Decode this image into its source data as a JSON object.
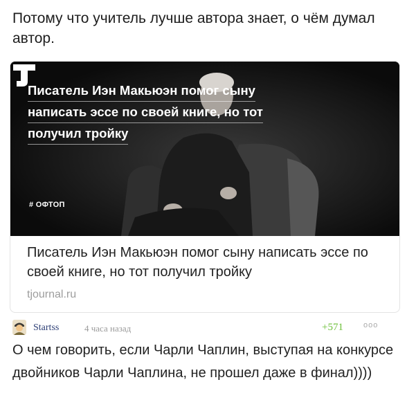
{
  "post": {
    "text": "Потому что учитель лучше автора знает, о чём думал автор."
  },
  "link_card": {
    "image": {
      "overlay_title_lines": [
        "Писатель Иэн Макьюэн помог сыну",
        "написать эссе по своей книге, но тот",
        "получил тройку"
      ],
      "hashtag": "# ОФТОП",
      "logo_icon": "tj-logo-icon"
    },
    "title": "Писатель Иэн Макьюэн помог сыну написать эссе по своей книге, но тот получил тройку",
    "domain": "tjournal.ru"
  },
  "comment": {
    "avatar_icon": "user-avatar-icon",
    "username": "Startss",
    "timestamp": "4 часа назад",
    "rating": "+571",
    "more_icon": "more-dots-icon",
    "more_label": "ooo",
    "text": "О чем говорить, если Чарли Чаплин, выступая на конкурсе двойников Чарли Чаплина, не прошел даже в финал))))"
  },
  "colors": {
    "username": "#2d3f76",
    "rating": "#6cbf39",
    "muted": "#9a9a9a"
  }
}
